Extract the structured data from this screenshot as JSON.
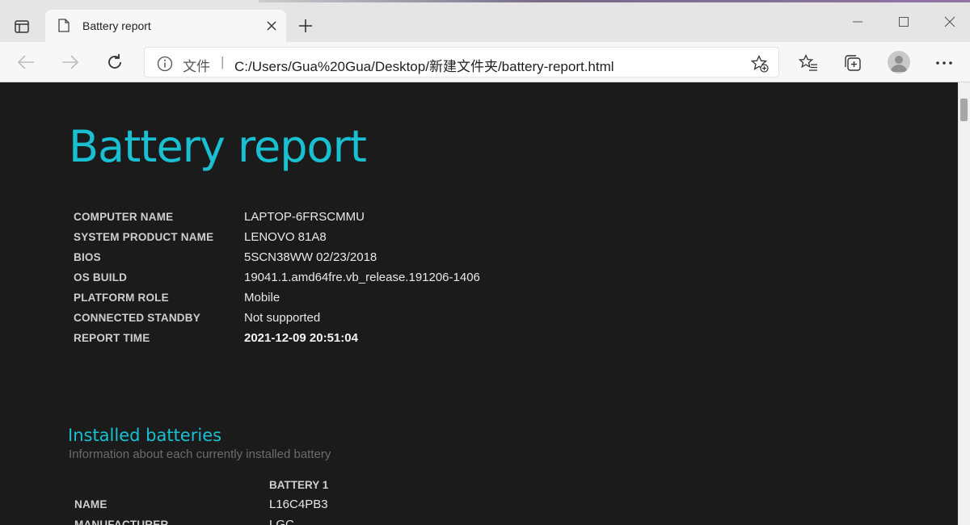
{
  "browser": {
    "tab": {
      "title": "Battery report"
    },
    "address": {
      "scheme_label": "文件",
      "separator": "|",
      "url": "C:/Users/Gua%20Gua/Desktop/新建文件夹/battery-report.html"
    },
    "icons": [
      "tab-actions-icon",
      "page-icon",
      "close-icon",
      "plus-icon",
      "minimize-icon",
      "maximize-icon",
      "window-close-icon",
      "back-arrow-icon",
      "forward-arrow-icon",
      "refresh-icon",
      "info-icon",
      "add-favorite-icon",
      "favorites-icon",
      "collections-icon",
      "profile-icon",
      "more-icon"
    ]
  },
  "report": {
    "title": "Battery report",
    "system_info": [
      {
        "label": "COMPUTER NAME",
        "value": "LAPTOP-6FRSCMMU"
      },
      {
        "label": "SYSTEM PRODUCT NAME",
        "value": "LENOVO 81A8"
      },
      {
        "label": "BIOS",
        "value": "5SCN38WW 02/23/2018"
      },
      {
        "label": "OS BUILD",
        "value": "19041.1.amd64fre.vb_release.191206-1406"
      },
      {
        "label": "PLATFORM ROLE",
        "value": "Mobile"
      },
      {
        "label": "CONNECTED STANDBY",
        "value": "Not supported"
      },
      {
        "label": "REPORT TIME",
        "value": "2021-12-09  20:51:04"
      }
    ],
    "installed_batteries": {
      "title": "Installed batteries",
      "subtitle": "Information about each currently installed battery",
      "column_header": "BATTERY 1",
      "rows": [
        {
          "label": "NAME",
          "value": "L16C4PB3"
        },
        {
          "label": "MANUFACTURER",
          "value": "LGC"
        }
      ]
    }
  },
  "colors": {
    "accent": "#19c0d2",
    "page_bg": "#1b1b1b",
    "chrome_bg": "#f7f7f7"
  }
}
